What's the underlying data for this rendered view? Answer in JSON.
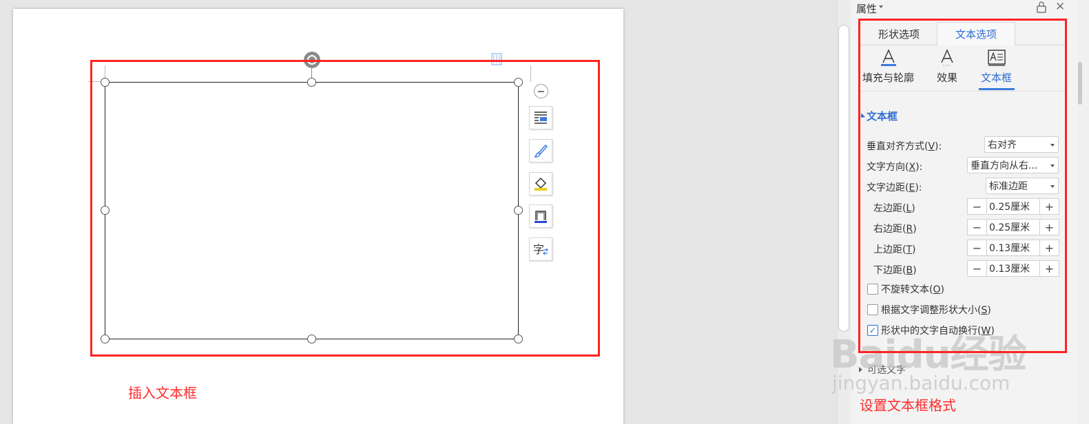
{
  "document": {
    "caption": "插入文本框"
  },
  "panel": {
    "title": "属性",
    "tabs": [
      {
        "label": "形状选项",
        "active": false
      },
      {
        "label": "文本选项",
        "active": true
      }
    ],
    "subtabs": [
      {
        "label": "填充与轮廓",
        "icon": "text-fill-icon"
      },
      {
        "label": "效果",
        "icon": "text-effect-icon"
      },
      {
        "label": "文本框",
        "icon": "textbox-icon",
        "active": true
      }
    ],
    "section_title": "文本框",
    "vertical_align": {
      "label": "垂直对齐方式(",
      "key": "V",
      "suffix": "):",
      "value": "右对齐"
    },
    "text_direction": {
      "label": "文字方向(",
      "key": "X",
      "suffix": "):",
      "value": "垂直方向从右..."
    },
    "text_margin": {
      "label": "文字边距(",
      "key": "E",
      "suffix": "):",
      "value": "标准边距"
    },
    "margins": [
      {
        "label": "左边距(",
        "key": "L",
        "suffix": ")",
        "value": "0.25厘米"
      },
      {
        "label": "右边距(",
        "key": "R",
        "suffix": ")",
        "value": "0.25厘米"
      },
      {
        "label": "上边距(",
        "key": "T",
        "suffix": ")",
        "value": "0.13厘米"
      },
      {
        "label": "下边距(",
        "key": "B",
        "suffix": ")",
        "value": "0.13厘米"
      }
    ],
    "stepper_minus": "−",
    "stepper_plus": "+",
    "checkboxes": [
      {
        "label": "不旋转文本(",
        "key": "O",
        "suffix": ")",
        "checked": false
      },
      {
        "label": "根据文字调整形状大小(",
        "key": "S",
        "suffix": ")",
        "checked": false
      },
      {
        "label": "形状中的文字自动换行(",
        "key": "W",
        "suffix": ")",
        "checked": true
      }
    ],
    "alt_text": "可选文字",
    "caption": "设置文本框格式"
  },
  "watermark": {
    "main": "Baidu经验",
    "sub": "jingyan.baidu.com"
  },
  "colors": {
    "accent": "#2d6ed3",
    "annotation_red": "#ff2222"
  }
}
